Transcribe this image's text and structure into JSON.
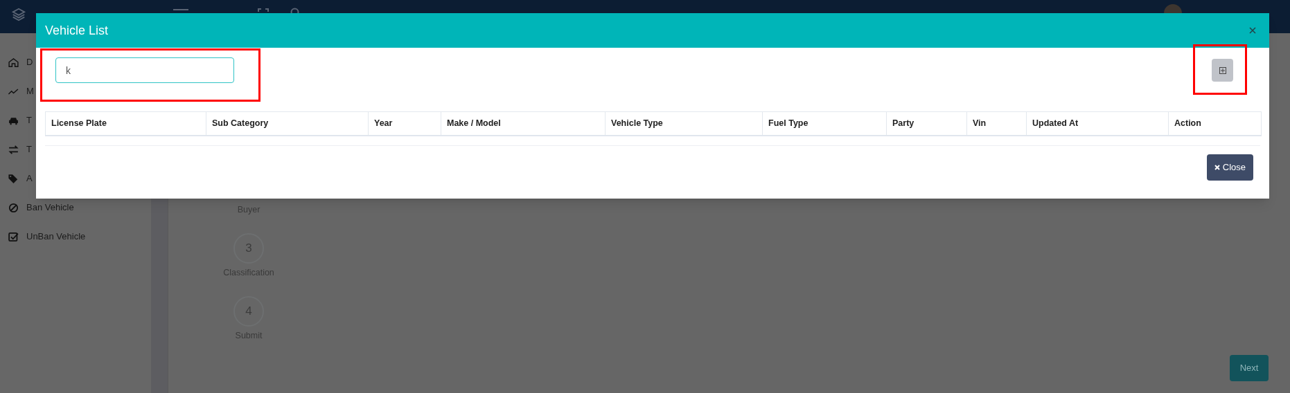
{
  "sidebar": {
    "items": [
      {
        "label": "D"
      },
      {
        "label": "M"
      },
      {
        "label": "T"
      },
      {
        "label": "T"
      },
      {
        "label": "A"
      },
      {
        "label": "Ban Vehicle"
      },
      {
        "label": "UnBan Vehicle"
      }
    ]
  },
  "stepper": {
    "steps": [
      {
        "label": "Buyer"
      },
      {
        "number": "3",
        "label": "Classification"
      },
      {
        "number": "4",
        "label": "Submit"
      }
    ]
  },
  "next_button": "Next",
  "modal": {
    "title": "Vehicle List",
    "search": {
      "value": "k"
    },
    "table": {
      "columns": [
        "License Plate",
        "Sub Category",
        "Year",
        "Make / Model",
        "Vehicle Type",
        "Fuel Type",
        "Party",
        "Vin",
        "Updated At",
        "Action"
      ]
    },
    "close_button": "Close"
  }
}
